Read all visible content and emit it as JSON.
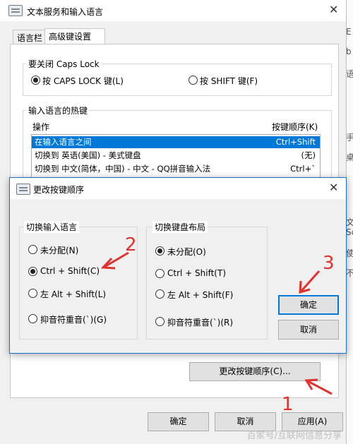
{
  "main_window": {
    "title": "文本服务和输入语言",
    "close_glyph": "✕",
    "tabs": [
      "语言栏",
      "高级键设置"
    ],
    "caps_group": {
      "title": "要关闭 Caps Lock",
      "options": [
        "按 CAPS LOCK 键(L)",
        "按 SHIFT 键(F)"
      ]
    },
    "hotkey_group": {
      "title": "输入语言的热键",
      "col_action": "操作",
      "col_sequence": "按键顺序(K)",
      "rows": [
        {
          "action": "在输入语言之间",
          "keys": "Ctrl+Shift"
        },
        {
          "action": "切换到 英语(美国) - 美式键盘",
          "keys": "(无)"
        },
        {
          "action": "切换到 中文(简体，中国) - 中文 - QQ拼音输入法",
          "keys": "Ctrl+`"
        }
      ]
    },
    "change_seq_button": "更改按键顺序(C)...",
    "ok_button": "确定",
    "cancel_button": "取消",
    "apply_button": "应用(A)"
  },
  "dialog": {
    "title": "更改按键顺序",
    "close_glyph": "✕",
    "input_lang_group": {
      "title": "切换输入语言",
      "options": [
        "未分配(N)",
        "Ctrl + Shift(C)",
        "左 Alt + Shift(L)",
        "抑音符重音(`)(G)"
      ],
      "selected": 1
    },
    "keyboard_layout_group": {
      "title": "切换键盘布局",
      "options": [
        "未分配(O)",
        "Ctrl + Shift(T)",
        "左 Alt + Shift(F)",
        "抑音符重音(`)(R)"
      ],
      "selected": 0
    },
    "ok_button": "确定",
    "cancel_button": "取消"
  },
  "annotations": {
    "steps": [
      "1",
      "2",
      "3"
    ],
    "color": "#e0332d"
  },
  "edge_glyphs": [
    "E",
    "b",
    "语",
    "手",
    "桌",
    "文",
    "Sc",
    "使",
    "不"
  ],
  "watermark": "百家号/互联网信息分享",
  "colors": {
    "selection": "#0078d7",
    "window_bg": "#f0f0f0",
    "annotation": "#e0332d"
  }
}
